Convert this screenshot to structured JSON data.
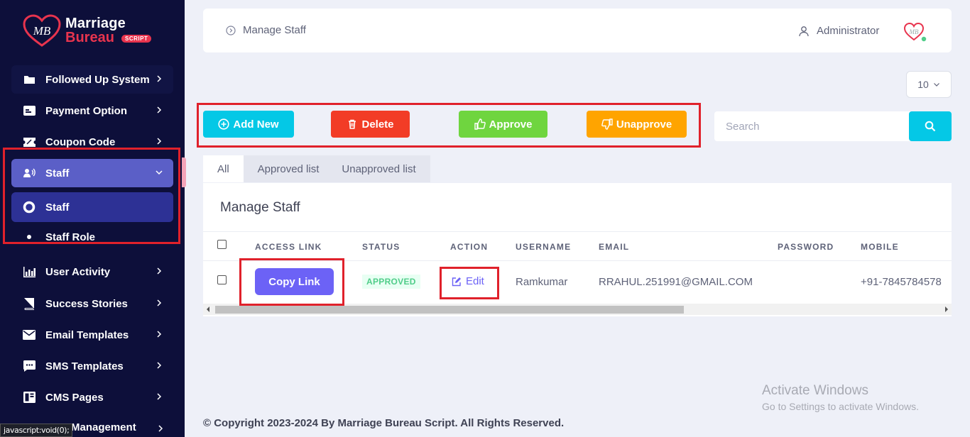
{
  "brand": {
    "line1": "Marriage",
    "line2": "Bureau",
    "badge": "SCRIPT",
    "monogram": "MB"
  },
  "sidebar": {
    "items": [
      {
        "label": "Followed Up System",
        "icon": "folder-open-icon"
      },
      {
        "label": "Payment Option",
        "icon": "id-card-icon"
      },
      {
        "label": "Coupon Code",
        "icon": "ticket-icon"
      },
      {
        "label": "Staff",
        "icon": "user-voice-icon",
        "expanded": true
      },
      {
        "label": "Staff",
        "icon": "radio-circle-icon",
        "active": true
      },
      {
        "label": "Staff Role",
        "icon": "dot-icon"
      },
      {
        "label": "User Activity",
        "icon": "bar-chart-icon"
      },
      {
        "label": "Success Stories",
        "icon": "book-icon"
      },
      {
        "label": "Email Templates",
        "icon": "envelope-icon"
      },
      {
        "label": "SMS Templates",
        "icon": "chat-bubble-icon"
      },
      {
        "label": "CMS Pages",
        "icon": "layout-icon"
      }
    ],
    "partial_label": "Management",
    "status_tip": "javascript:void(0);"
  },
  "header": {
    "breadcrumb": "Manage Staff",
    "user": "Administrator"
  },
  "page_size": "10",
  "actions": {
    "add": "Add New",
    "delete": "Delete",
    "approve": "Approve",
    "unapprove": "Unapprove"
  },
  "search": {
    "placeholder": "Search"
  },
  "tabs": [
    "All",
    "Approved list",
    "Unapproved list"
  ],
  "table": {
    "title": "Manage Staff",
    "columns": [
      "ACCESS LINK",
      "STATUS",
      "ACTION",
      "USERNAME",
      "EMAIL",
      "PASSWORD",
      "MOBILE"
    ],
    "rows": [
      {
        "access_link": "Copy Link",
        "status": "APPROVED",
        "action": "Edit",
        "username": "Ramkumar",
        "email": "RRAHUL.251991@GMAIL.COM",
        "password": "",
        "mobile": "+91-7845784578"
      }
    ]
  },
  "watermark": {
    "line1": "Activate Windows",
    "line2": "Go to Settings to activate Windows."
  },
  "footer": {
    "copyright": "© Copyright 2023-2024 By Marriage Bureau Script. All Rights Reserved."
  },
  "colors": {
    "sidebar": "#0d0f3a",
    "staff_parent": "#5b5fc7",
    "staff_active": "#2d3195",
    "add": "#04c8e6",
    "delete": "#f23c26",
    "approve": "#6fd53f",
    "unapprove": "#ffa400",
    "copy_link": "#6c62f6",
    "highlight": "#e0212b"
  }
}
